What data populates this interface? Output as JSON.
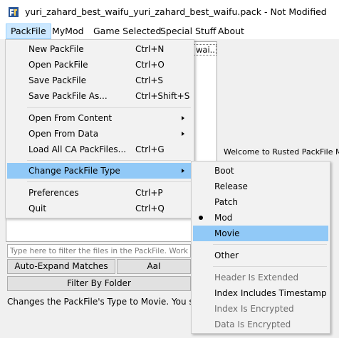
{
  "window": {
    "title": "yuri_zahard_best_waifu_yuri_zahard_best_waifu.pack - Not Modified"
  },
  "menubar": [
    "PackFile",
    "MyMod",
    "Game Selected",
    "Special Stuff",
    "About"
  ],
  "packfile_menu": {
    "items": [
      {
        "label": "New PackFile",
        "shortcut": "Ctrl+N"
      },
      {
        "label": "Open PackFile",
        "shortcut": "Ctrl+O"
      },
      {
        "label": "Save PackFile",
        "shortcut": "Ctrl+S"
      },
      {
        "label": "Save PackFile As...",
        "shortcut": "Ctrl+Shift+S"
      },
      {
        "label": "Open From Content",
        "shortcut": ""
      },
      {
        "label": "Open From Data",
        "shortcut": ""
      },
      {
        "label": "Load All CA PackFiles...",
        "shortcut": "Ctrl+G"
      },
      {
        "label": "Change PackFile Type",
        "shortcut": ""
      },
      {
        "label": "Preferences",
        "shortcut": "Ctrl+P"
      },
      {
        "label": "Quit",
        "shortcut": "Ctrl+Q"
      }
    ]
  },
  "type_submenu": {
    "items": [
      {
        "label": "Boot"
      },
      {
        "label": "Release"
      },
      {
        "label": "Patch"
      },
      {
        "label": "Mod",
        "checked": true
      },
      {
        "label": "Movie",
        "highlighted": true
      },
      {
        "label": "Other"
      },
      {
        "label": "Header Is Extended",
        "enabled": false
      },
      {
        "label": "Index Includes Timestamp",
        "enabled": true
      },
      {
        "label": "Index Is Encrypted",
        "enabled": false
      },
      {
        "label": "Data Is Encrypted",
        "enabled": false
      }
    ]
  },
  "background": {
    "tree_item": "wai...",
    "welcome_text": "Welcome to Rusted PackFile Mana",
    "filter_placeholder": "Type here to filter the files in the PackFile. Works with Regex too!",
    "auto_expand_button": "Auto-Expand Matches",
    "aai_button": "AaI",
    "filter_by_folder_button": "Filter By Folder",
    "status_text": "Changes the PackFile's Type to Movie. You shou"
  },
  "colors": {
    "highlight": "#91c9f7",
    "menubar_active": "#cce8ff",
    "menu_bg": "#f2f2f2",
    "disabled_text": "#6d6d6d"
  }
}
